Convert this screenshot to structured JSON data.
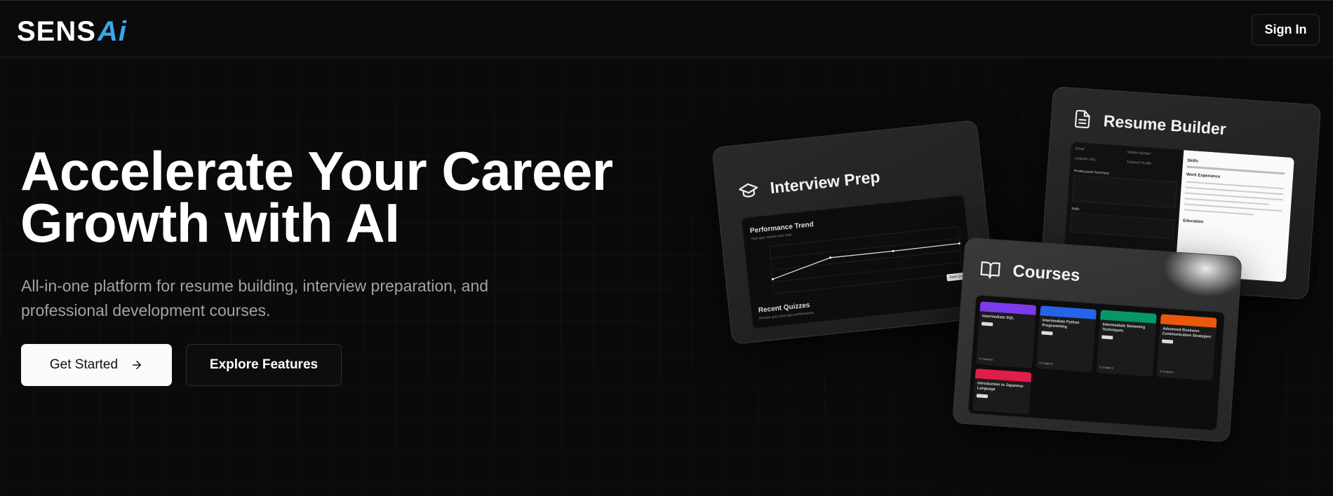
{
  "header": {
    "logo_main": "SENS",
    "logo_accent": "Ai",
    "signin_label": "Sign In"
  },
  "hero": {
    "title_line1": "Accelerate Your Career",
    "title_line2": "Growth with AI",
    "subtitle_line1": "All-in-one platform for resume building, interview preparation, and",
    "subtitle_line2": "professional development courses.",
    "primary_button": "Get Started",
    "secondary_button": "Explore Features"
  },
  "cards": {
    "interview": {
      "title": "Interview Prep",
      "chart_title": "Performance Trend",
      "chart_subtitle": "Your quiz scores over time",
      "recent_title": "Recent Quizzes",
      "recent_subtitle": "Review your past quiz performance",
      "tab_label": "Start Quiz"
    },
    "resume": {
      "title": "Resume Builder",
      "left_labels": [
        "Email",
        "Mobile Number",
        "LinkedIn URL",
        "Twitter/X Profile",
        "Professional Summary",
        "Skills"
      ],
      "right_sections": [
        "Skills",
        "Work Experience",
        "Education"
      ]
    },
    "courses": {
      "title": "Courses",
      "items": [
        {
          "name": "Intermediate SQL",
          "color": "#7c3aed",
          "chapters": "6 Chapters"
        },
        {
          "name": "Intermediate Python Programming",
          "color": "#2563eb",
          "chapters": "6 Chapters"
        },
        {
          "name": "Intermediate Stemming Techniques",
          "color": "#059669",
          "chapters": "6 Chapters"
        },
        {
          "name": "Advanced Business Communication Strategies",
          "color": "#ea580c",
          "chapters": "6 Chapters"
        },
        {
          "name": "Introduction to Japanese Language",
          "color": "#e11d48",
          "chapters": ""
        }
      ]
    }
  },
  "colors": {
    "accent_logo": "#3aa6e8",
    "background": "#0a0a0a",
    "primary_button_bg": "#fafafa"
  }
}
